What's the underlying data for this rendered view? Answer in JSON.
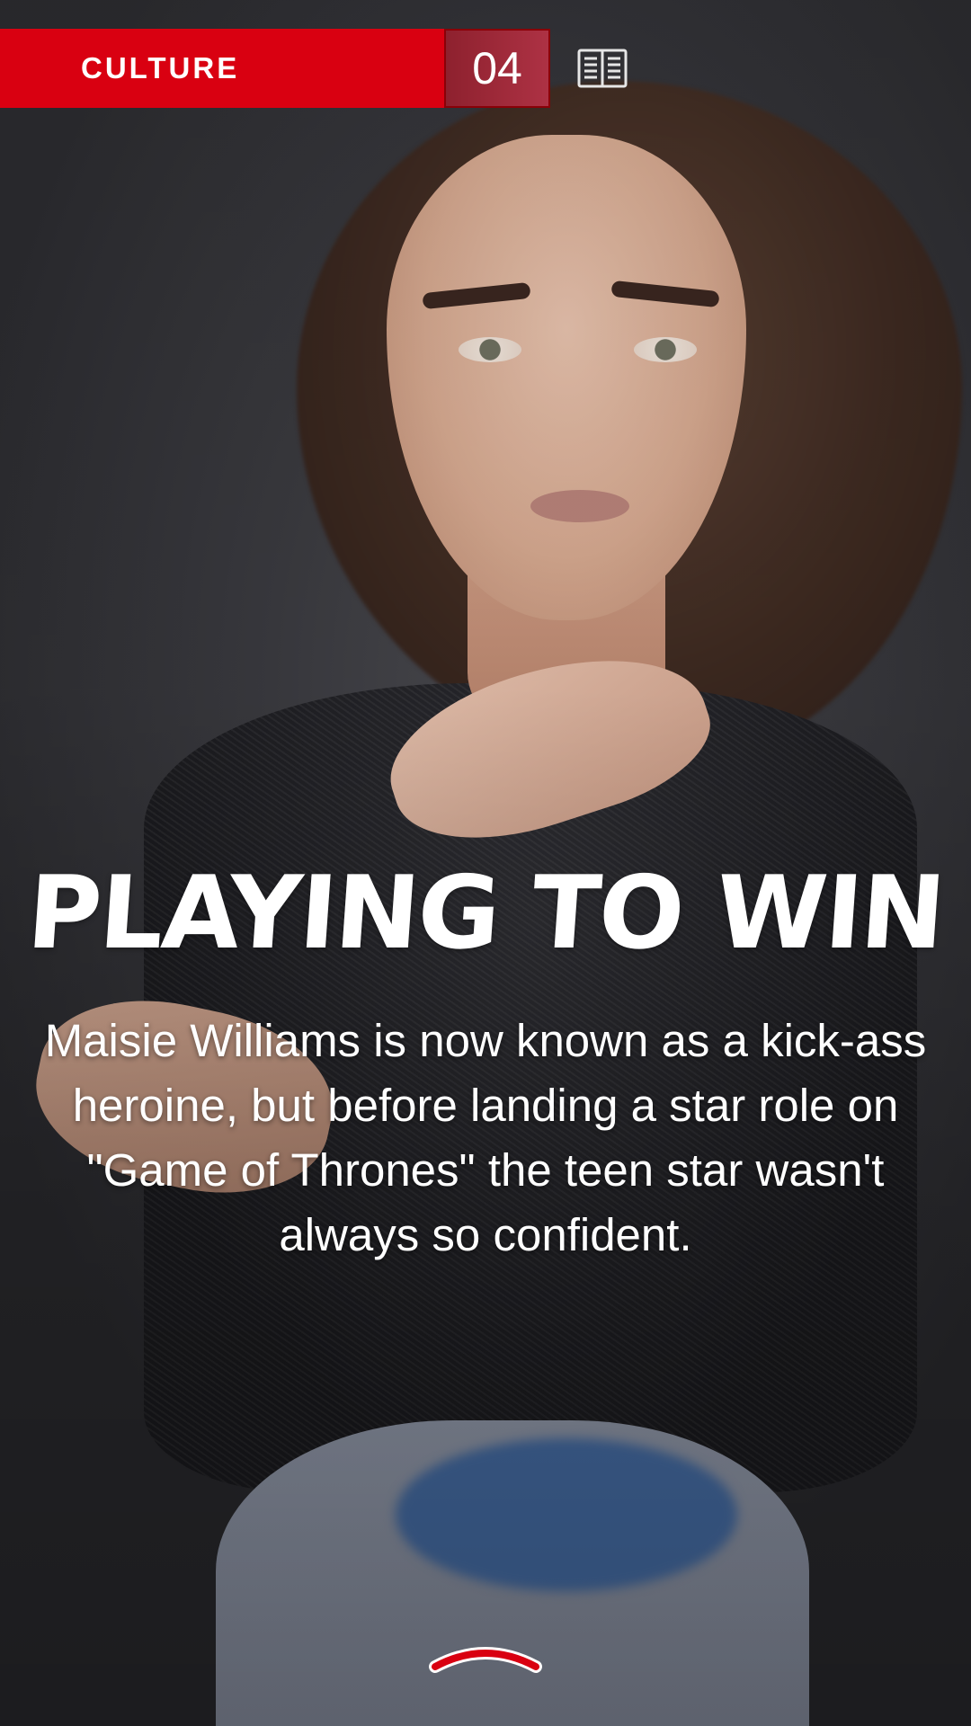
{
  "header": {
    "section": "CULTURE",
    "page_number": "04",
    "reader_icon": "open-book-icon"
  },
  "story": {
    "headline": "PLAYING TO WIN",
    "dek": "Maisie Williams is now known as a kick-ass heroine, but before landing a star role on \"Game of Thrones\" the teen star wasn't always so confident."
  },
  "navigation": {
    "swipe_icon": "chevron-up-icon"
  },
  "colors": {
    "accent": "#d90011",
    "text": "#ffffff"
  }
}
